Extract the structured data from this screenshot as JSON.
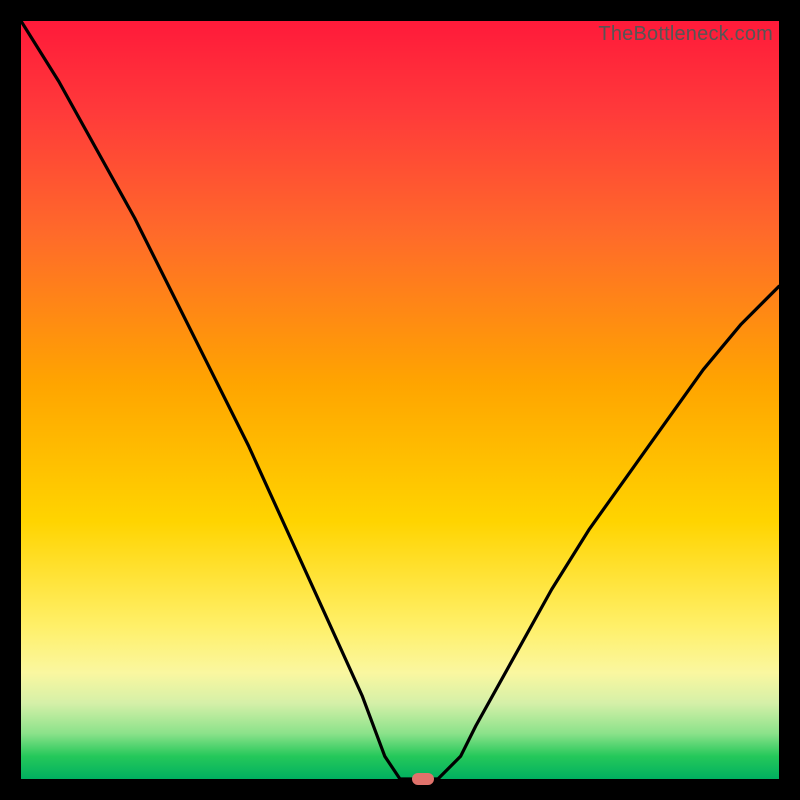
{
  "watermark": "TheBottleneck.com",
  "chart_data": {
    "type": "line",
    "title": "",
    "xlabel": "",
    "ylabel": "",
    "xlim": [
      0,
      100
    ],
    "ylim": [
      0,
      100
    ],
    "background_gradient": {
      "orientation": "vertical",
      "stops": [
        {
          "pos": 0,
          "color": "#ff1a3a"
        },
        {
          "pos": 12,
          "color": "#ff3a3a"
        },
        {
          "pos": 28,
          "color": "#ff6a2a"
        },
        {
          "pos": 48,
          "color": "#ffa500"
        },
        {
          "pos": 66,
          "color": "#ffd400"
        },
        {
          "pos": 80,
          "color": "#fff06a"
        },
        {
          "pos": 86,
          "color": "#faf7a0"
        },
        {
          "pos": 90,
          "color": "#d5f0a8"
        },
        {
          "pos": 94,
          "color": "#8be28a"
        },
        {
          "pos": 97,
          "color": "#25c85a"
        },
        {
          "pos": 100,
          "color": "#00b060"
        }
      ]
    },
    "series": [
      {
        "name": "bottleneck-curve",
        "color": "#000000",
        "x": [
          0,
          5,
          10,
          15,
          20,
          25,
          30,
          35,
          40,
          45,
          48,
          50,
          52,
          55,
          58,
          60,
          65,
          70,
          75,
          80,
          85,
          90,
          95,
          100
        ],
        "y": [
          100,
          92,
          83,
          74,
          64,
          54,
          44,
          33,
          22,
          11,
          3,
          0,
          0,
          0,
          3,
          7,
          16,
          25,
          33,
          40,
          47,
          54,
          60,
          65
        ]
      }
    ],
    "marker": {
      "x": 53,
      "y": 0,
      "color": "#e0726b"
    }
  }
}
